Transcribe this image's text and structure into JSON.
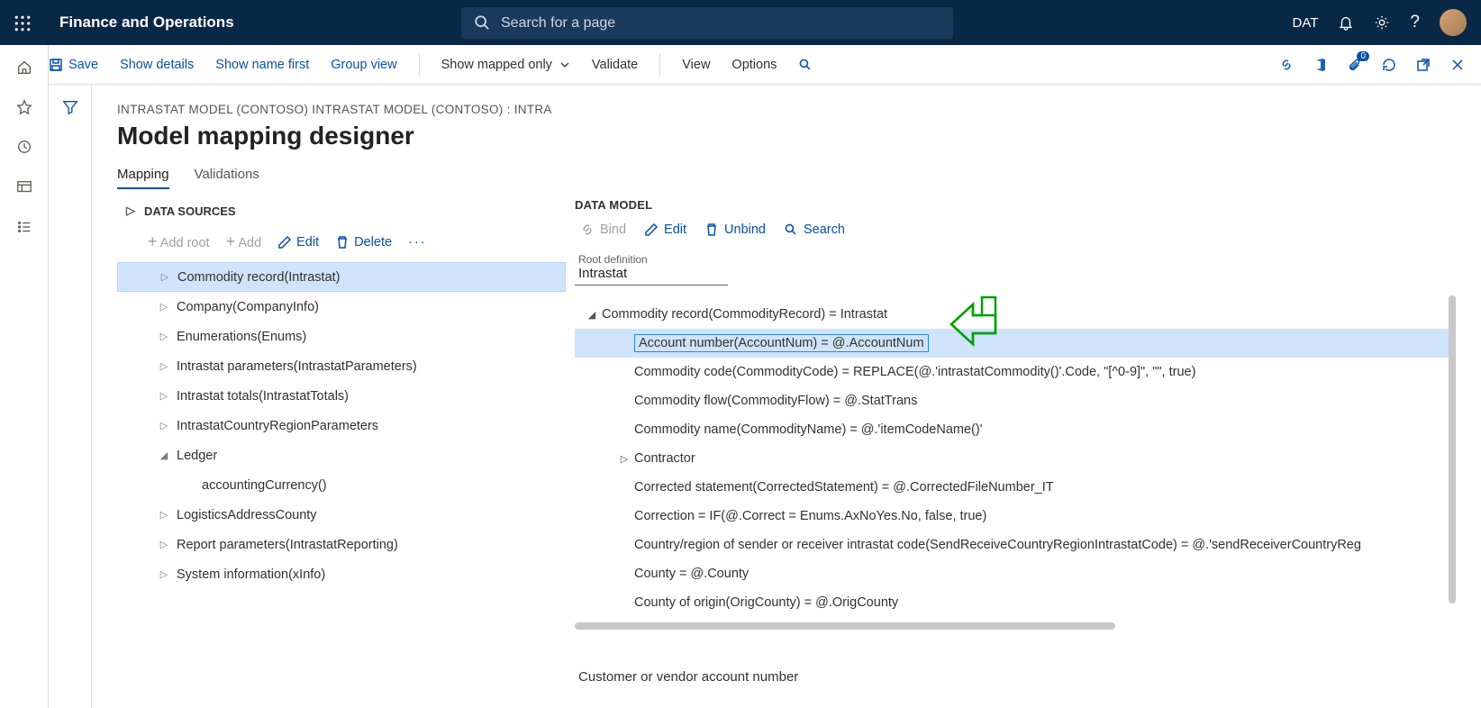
{
  "nav": {
    "app_title": "Finance and Operations",
    "search_placeholder": "Search for a page",
    "dat": "DAT"
  },
  "toolbar": {
    "save": "Save",
    "show_details": "Show details",
    "show_name_first": "Show name first",
    "group_view": "Group view",
    "show_mapped_only": "Show mapped only",
    "validate": "Validate",
    "view": "View",
    "options": "Options",
    "badge_count": "0"
  },
  "page": {
    "breadcrumb": "INTRASTAT MODEL (CONTOSO) INTRASTAT MODEL (CONTOSO) : INTRA",
    "title": "Model mapping designer"
  },
  "tabs": {
    "mapping": "Mapping",
    "validations": "Validations"
  },
  "ds": {
    "header": "DATA SOURCES",
    "add_root": "Add root",
    "add": "Add",
    "edit": "Edit",
    "delete": "Delete",
    "items": [
      {
        "label": "Commodity record(Intrastat)",
        "selected": true
      },
      {
        "label": "Company(CompanyInfo)"
      },
      {
        "label": "Enumerations(Enums)"
      },
      {
        "label": "Intrastat parameters(IntrastatParameters)"
      },
      {
        "label": "Intrastat totals(IntrastatTotals)"
      },
      {
        "label": "IntrastatCountryRegionParameters"
      },
      {
        "label": "Ledger",
        "expanded": true
      },
      {
        "label": "accountingCurrency()",
        "child": true
      },
      {
        "label": "LogisticsAddressCounty"
      },
      {
        "label": "Report parameters(IntrastatReporting)"
      },
      {
        "label": "System information(xInfo)"
      }
    ]
  },
  "dm": {
    "header": "DATA MODEL",
    "bind": "Bind",
    "edit": "Edit",
    "unbind": "Unbind",
    "search": "Search",
    "root_label": "Root definition",
    "root_value": "Intrastat",
    "rows": [
      {
        "text": "Commodity record(CommodityRecord) = Intrastat",
        "level": 0,
        "expanded": true
      },
      {
        "text": "Account number(AccountNum) = @.AccountNum",
        "level": 1,
        "selected": true
      },
      {
        "text": "Commodity code(CommodityCode) = REPLACE(@.'intrastatCommodity()'.Code, \"[^0-9]\", \"\", true)",
        "level": 1
      },
      {
        "text": "Commodity flow(CommodityFlow) = @.StatTrans",
        "level": 1
      },
      {
        "text": "Commodity name(CommodityName) = @.'itemCodeName()'",
        "level": 1
      },
      {
        "text": "Contractor",
        "level": 1,
        "caret": true
      },
      {
        "text": "Corrected statement(CorrectedStatement) = @.CorrectedFileNumber_IT",
        "level": 1
      },
      {
        "text": "Correction = IF(@.Correct = Enums.AxNoYes.No, false, true)",
        "level": 1
      },
      {
        "text": "Country/region of sender or receiver intrastat code(SendReceiveCountryRegionIntrastatCode) = @.'sendReceiverCountryReg",
        "level": 1
      },
      {
        "text": "County = @.County",
        "level": 1
      },
      {
        "text": "County of origin(OrigCounty) = @.OrigCounty",
        "level": 1
      }
    ],
    "description": "Customer or vendor account number"
  }
}
